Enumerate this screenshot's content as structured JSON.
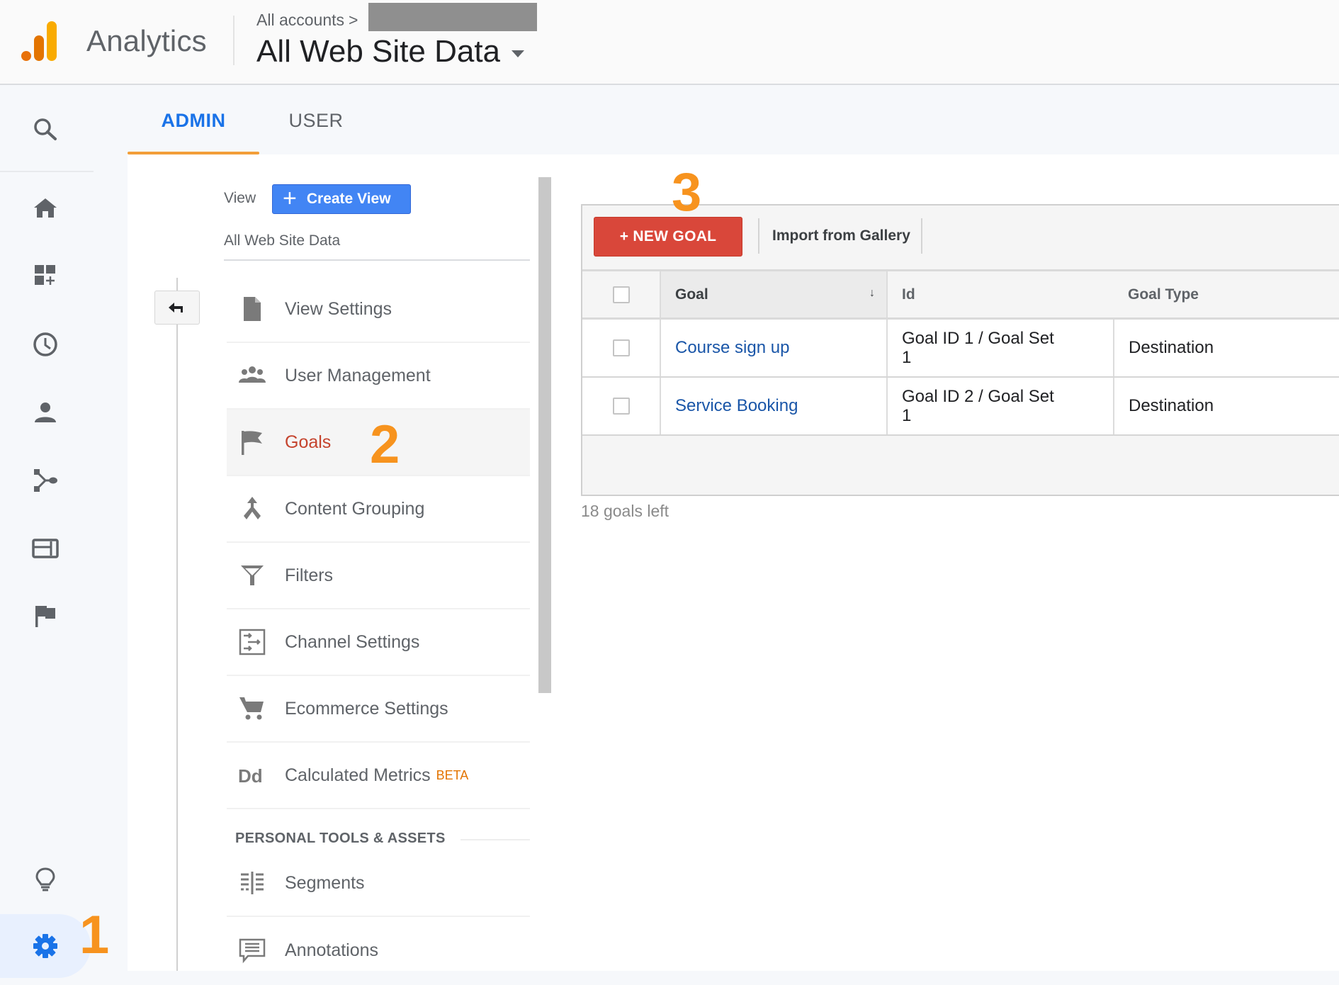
{
  "header": {
    "app_name": "Analytics",
    "breadcrumb": "All accounts",
    "breadcrumb_separator": ">",
    "view_title": "All Web Site Data",
    "logo_colors": [
      "#e37400",
      "#e8710a",
      "#f9ab00"
    ]
  },
  "rail": {
    "items": [
      {
        "icon": "search-icon",
        "label": "Search"
      },
      {
        "icon": "home-icon",
        "label": "Home"
      },
      {
        "icon": "customization-icon",
        "label": "Customization"
      },
      {
        "icon": "realtime-clock-icon",
        "label": "Realtime"
      },
      {
        "icon": "audience-person-icon",
        "label": "Audience"
      },
      {
        "icon": "acquisition-icon",
        "label": "Acquisition"
      },
      {
        "icon": "behavior-icon",
        "label": "Behavior"
      },
      {
        "icon": "conversions-flag-icon",
        "label": "Conversions"
      },
      {
        "icon": "discover-lightbulb-icon",
        "label": "Discover"
      },
      {
        "icon": "admin-gear-icon",
        "label": "Admin",
        "active": true
      }
    ]
  },
  "tabs": [
    {
      "label": "ADMIN",
      "active": true
    },
    {
      "label": "USER",
      "active": false
    }
  ],
  "view_column": {
    "label": "View",
    "create_button": "Create View",
    "current_view": "All Web Site Data",
    "menu": [
      {
        "icon": "document-icon",
        "label": "View Settings"
      },
      {
        "icon": "people-icon",
        "label": "User Management"
      },
      {
        "icon": "flag-icon",
        "label": "Goals",
        "active": true
      },
      {
        "icon": "content-grouping-icon",
        "label": "Content Grouping"
      },
      {
        "icon": "filter-icon",
        "label": "Filters"
      },
      {
        "icon": "channel-settings-icon",
        "label": "Channel Settings"
      },
      {
        "icon": "cart-icon",
        "label": "Ecommerce Settings"
      },
      {
        "icon": "dd-icon",
        "label": "Calculated Metrics",
        "badge": "BETA"
      }
    ],
    "section_header": "PERSONAL TOOLS & ASSETS",
    "personal_menu": [
      {
        "icon": "segments-icon",
        "label": "Segments"
      },
      {
        "icon": "annotations-icon",
        "label": "Annotations"
      }
    ]
  },
  "goals": {
    "new_goal_button": "+ NEW GOAL",
    "import_button": "Import from Gallery",
    "columns": [
      "Goal",
      "Id",
      "Goal Type"
    ],
    "sorted_column": "Goal",
    "sort_indicator": "↓",
    "rows": [
      {
        "goal": "Course sign up",
        "id_line1": "Goal ID 1 / Goal Set",
        "id_line2": "1",
        "type": "Destination"
      },
      {
        "goal": "Service Booking",
        "id_line1": "Goal ID 2 / Goal Set",
        "id_line2": "1",
        "type": "Destination"
      }
    ],
    "goals_left": "18 goals left"
  },
  "annotations": [
    "1",
    "2",
    "3"
  ],
  "colors": {
    "accent_blue": "#1a73e8",
    "tab_underline": "#f29e38",
    "new_goal_red": "#d9473a",
    "create_view_blue": "#4285f4",
    "active_menu_text": "#c5442e",
    "annotation_orange": "#f7931e"
  }
}
